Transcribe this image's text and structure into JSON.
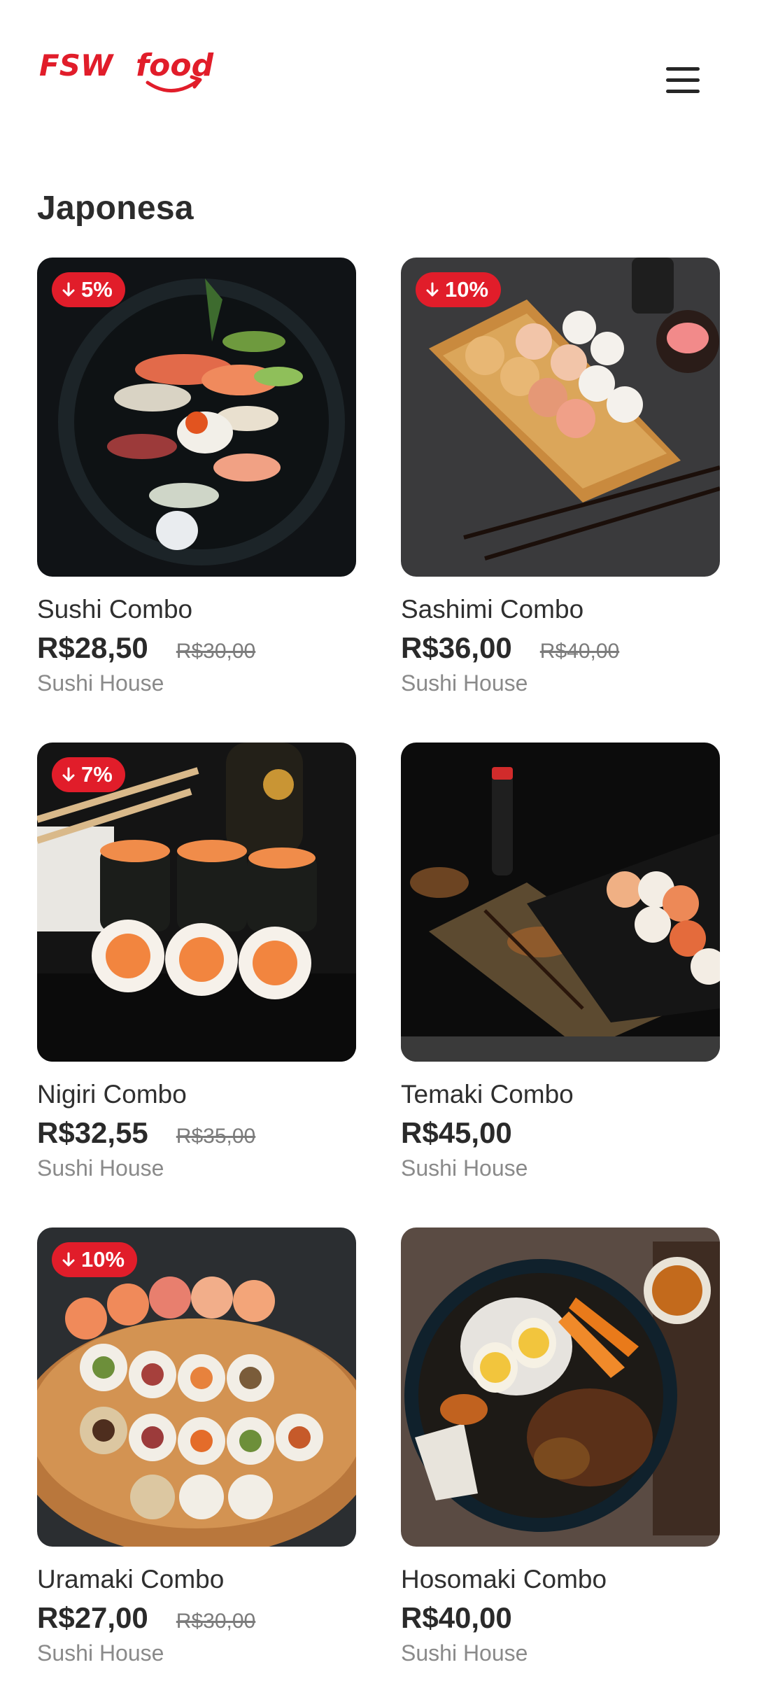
{
  "header": {
    "logo_text_fsw": "FSW",
    "logo_text_food": "food",
    "menu_icon": "hamburger-menu-icon"
  },
  "category": {
    "title": "Japonesa"
  },
  "colors": {
    "brand_red": "#e11d2a",
    "text_dark": "#2a2a2a",
    "text_muted": "#8a8a8a"
  },
  "products": [
    {
      "name": "Sushi Combo",
      "price": "R$28,50",
      "old_price": "R$30,00",
      "discount": "5%",
      "restaurant": "Sushi House"
    },
    {
      "name": "Sashimi Combo",
      "price": "R$36,00",
      "old_price": "R$40,00",
      "discount": "10%",
      "restaurant": "Sushi House"
    },
    {
      "name": "Nigiri Combo",
      "price": "R$32,55",
      "old_price": "R$35,00",
      "discount": "7%",
      "restaurant": "Sushi House"
    },
    {
      "name": "Temaki Combo",
      "price": "R$45,00",
      "old_price": "",
      "discount": "",
      "restaurant": "Sushi House"
    },
    {
      "name": "Uramaki Combo",
      "price": "R$27,00",
      "old_price": "R$30,00",
      "discount": "10%",
      "restaurant": "Sushi House"
    },
    {
      "name": "Hosomaki Combo",
      "price": "R$40,00",
      "old_price": "",
      "discount": "",
      "restaurant": "Sushi House"
    }
  ]
}
